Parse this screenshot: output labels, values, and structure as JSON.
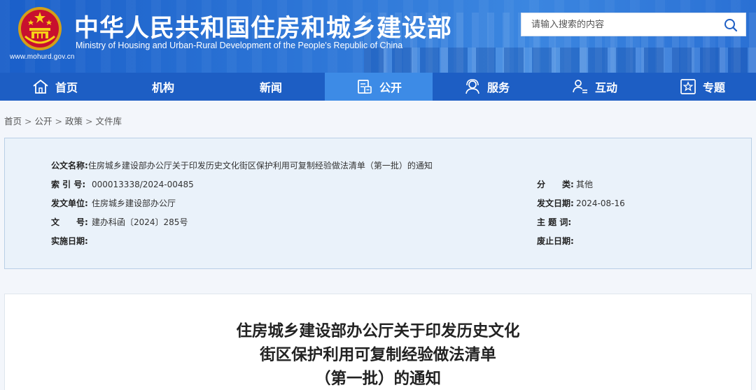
{
  "header": {
    "title": "中华人民共和国住房和城乡建设部",
    "subtitle": "Ministry of Housing and Urban-Rural Development of the People's Republic of China",
    "url": "www.mohurd.gov.cn",
    "search_placeholder": "请输入搜索的内容",
    "emblem_icon": "national-emblem-icon",
    "search_icon": "search-icon"
  },
  "nav": {
    "items": [
      {
        "label": "首页",
        "icon": "home-icon"
      },
      {
        "label": "机构"
      },
      {
        "label": "新闻"
      },
      {
        "label": "公开",
        "icon": "document-icon",
        "active": true
      },
      {
        "label": "服务",
        "icon": "service-icon"
      },
      {
        "label": "互动",
        "icon": "interaction-icon"
      },
      {
        "label": "专题",
        "icon": "star-icon"
      }
    ]
  },
  "breadcrumb": [
    "首页",
    "公开",
    "政策",
    "文件库"
  ],
  "meta": {
    "doc_name_label": "公文名称:",
    "doc_name": "住房城乡建设部办公厅关于印发历史文化街区保护利用可复制经验做法清单（第一批）的通知",
    "index_label": "索 引 号:",
    "index_value": "000013338/2024-00485",
    "category_label": "分　　类:",
    "category_value": "其他",
    "issuer_label": "发文单位:",
    "issuer_value": "住房城乡建设部办公厅",
    "date_label": "发文日期:",
    "date_value": "2024-08-16",
    "docno_label": "文　　号:",
    "docno_value": "建办科函〔2024〕285号",
    "keywords_label": "主 题 词:",
    "keywords_value": "",
    "effective_label": "实施日期:",
    "effective_value": "",
    "expiry_label": "废止日期:",
    "expiry_value": ""
  },
  "article": {
    "title_lines": [
      "住房城乡建设部办公厅关于印发历史文化",
      "街区保护利用可复制经验做法清单",
      "（第一批）的通知"
    ]
  },
  "colors": {
    "nav_bg": "#1d5ec4",
    "nav_active": "#3d8be6",
    "meta_bg": "#eaf2fa"
  }
}
